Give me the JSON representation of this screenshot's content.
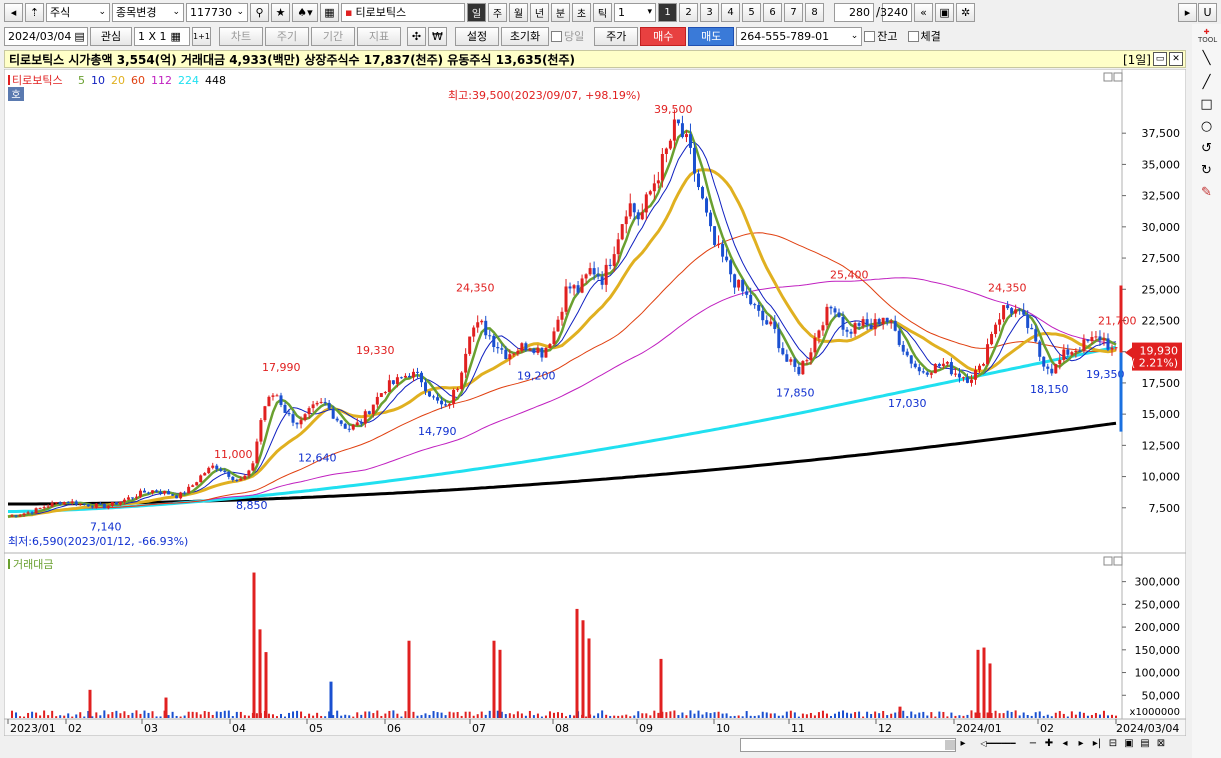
{
  "toolbar": {
    "market_label": "주식",
    "change_label": "종목변경",
    "code_value": "117730",
    "stock_name": "티로보틱스",
    "periods": [
      "일",
      "주",
      "월",
      "년",
      "분",
      "초",
      "틱"
    ],
    "period_count": "1",
    "page_buttons": [
      "1",
      "2",
      "3",
      "4",
      "5",
      "6",
      "7",
      "8"
    ],
    "count_value": "280",
    "total_value": "3240",
    "date_value": "2024/03/04",
    "watch_label": "관심",
    "ratio_label": "1 X 1",
    "plus_one_label": "1+1",
    "chart_label": "차트",
    "cycle_label": "주기",
    "range_label": "기간",
    "indicator_label": "지표",
    "won_label": "₩",
    "settings_label": "설정",
    "reset_label": "초기화",
    "same_day_label": "당일",
    "price_label": "주가",
    "buy_label": "매수",
    "sell_label": "매도",
    "account_value": "264-555-789-01",
    "balance_label": "잔고",
    "fill_label": "체결",
    "u_label": "U"
  },
  "right_tools": {
    "tool_label": "TOOL"
  },
  "info_bar": {
    "text": "티로보틱스  시가총액 3,554(억)  거래대금 4,933(백만)  상장주식수 17,837(천주)  유동주식 13,635(천주)",
    "period_tag": "[1일]"
  },
  "chart_data": [
    {
      "type": "candlestick",
      "name": "price",
      "legend": [
        "티로보틱스",
        "5",
        "10",
        "20",
        "60",
        "112",
        "224",
        "448"
      ],
      "legend_colors": [
        "#e02020",
        "#6aa030",
        "#1020c0",
        "#e0b020",
        "#e04010",
        "#c020c0",
        "#20e0f0",
        "#000000"
      ],
      "hoga_label": "호",
      "y_ticks": [
        7500,
        10000,
        12500,
        15000,
        17500,
        20000,
        22500,
        25000,
        27500,
        30000,
        32500,
        35000,
        37500
      ],
      "y_tick_labels": [
        "7,500",
        "10,000",
        "12,500",
        "15,000",
        "17,500",
        "20,000",
        "22,500",
        "25,000",
        "27,500",
        "30,000",
        "32,500",
        "35,000",
        "37,500"
      ],
      "ylim": [
        5000,
        42000
      ],
      "x_tick_labels": [
        "2023/01",
        "02",
        "03",
        "04",
        "05",
        "06",
        "07",
        "08",
        "09",
        "10",
        "11",
        "12",
        "2024/01",
        "02",
        "2024/03/04"
      ],
      "closes_weekly": [
        6800,
        7000,
        7200,
        7600,
        7900,
        8000,
        7800,
        7700,
        7600,
        7900,
        8300,
        8700,
        8900,
        8700,
        8400,
        9100,
        10200,
        10900,
        10300,
        9600,
        10400,
        15500,
        16800,
        14900,
        14200,
        15400,
        15900,
        14700,
        13800,
        14300,
        15800,
        17100,
        17600,
        18300,
        17800,
        16200,
        15400,
        17300,
        21800,
        22100,
        20800,
        19800,
        20300,
        20600,
        19900,
        21800,
        25200,
        24900,
        26700,
        25800,
        28800,
        32000,
        30600,
        33200,
        35500,
        38300,
        36200,
        32500,
        28700,
        27100,
        25300,
        24100,
        22600,
        21800,
        19300,
        18400,
        20100,
        22600,
        23800,
        21400,
        22300,
        21900,
        22900,
        21600,
        19700,
        18400,
        18700,
        19000,
        18300,
        17900,
        18600,
        21900,
        23600,
        23200,
        21900,
        19400,
        18500,
        19900,
        20300,
        20800,
        21200,
        19900
      ],
      "ma_labels": [
        {
          "text": "최고:39,500(2023/09/07, +98.19%)",
          "color": "#e02020"
        },
        {
          "text": "39,500",
          "color": "#e02020"
        },
        {
          "text": "최저:6,590(2023/01/12, -66.93%)",
          "color": "#1030d0"
        }
      ],
      "peak_labels": [
        {
          "text": "11,000",
          "value": 11000,
          "color": "#e02020"
        },
        {
          "text": "17,990",
          "value": 17990,
          "color": "#e02020"
        },
        {
          "text": "19,330",
          "value": 19330,
          "color": "#e02020"
        },
        {
          "text": "24,350",
          "value": 24350,
          "color": "#e02020"
        },
        {
          "text": "25,400",
          "value": 25400,
          "color": "#e02020"
        },
        {
          "text": "24,350",
          "value": 24350,
          "color": "#e02020"
        },
        {
          "text": "21,700",
          "value": 21700,
          "color": "#e02020"
        },
        {
          "text": "7,140",
          "value": 7140,
          "color": "#1030d0"
        },
        {
          "text": "8,850",
          "value": 8850,
          "color": "#1030d0"
        },
        {
          "text": "12,640",
          "value": 12640,
          "color": "#1030d0"
        },
        {
          "text": "14,790",
          "value": 14790,
          "color": "#1030d0"
        },
        {
          "text": "19,200",
          "value": 19200,
          "color": "#1030d0"
        },
        {
          "text": "17,850",
          "value": 17850,
          "color": "#1030d0"
        },
        {
          "text": "17,030",
          "value": 17030,
          "color": "#1030d0"
        },
        {
          "text": "18,150",
          "value": 18150,
          "color": "#1030d0"
        },
        {
          "text": "19,350",
          "value": 19350,
          "color": "#1030d0"
        }
      ],
      "current_price": {
        "value": 19930,
        "label": "19,930",
        "change": "( 2.21%)",
        "color": "#e02020"
      }
    },
    {
      "type": "bar",
      "name": "거래대금",
      "legend": [
        "거래대금"
      ],
      "y_ticks": [
        50000,
        100000,
        150000,
        200000,
        250000,
        300000
      ],
      "y_tick_labels": [
        "50,000",
        "100,000",
        "150,000",
        "200,000",
        "250,000",
        "300,000"
      ],
      "unit_label": "x1000000",
      "ylim": [
        0,
        330000
      ],
      "spikes": [
        {
          "month": "02",
          "value": 62000,
          "color": "#e02020"
        },
        {
          "month": "03",
          "value": 45000,
          "color": "#e02020"
        },
        {
          "month": "04",
          "value": 320000,
          "color": "#e02020"
        },
        {
          "month": "04",
          "value": 195000,
          "color": "#e02020"
        },
        {
          "month": "04",
          "value": 145000,
          "color": "#e02020"
        },
        {
          "month": "05",
          "value": 80000,
          "color": "#1a50d0"
        },
        {
          "month": "06",
          "value": 170000,
          "color": "#e02020"
        },
        {
          "month": "07",
          "value": 170000,
          "color": "#e02020"
        },
        {
          "month": "07",
          "value": 150000,
          "color": "#e02020"
        },
        {
          "month": "08",
          "value": 240000,
          "color": "#e02020"
        },
        {
          "month": "08",
          "value": 215000,
          "color": "#e02020"
        },
        {
          "month": "08",
          "value": 175000,
          "color": "#e02020"
        },
        {
          "month": "09",
          "value": 130000,
          "color": "#e02020"
        },
        {
          "month": "12",
          "value": 25000,
          "color": "#e02020"
        },
        {
          "month": "2024/01",
          "value": 150000,
          "color": "#e02020"
        },
        {
          "month": "2024/01",
          "value": 155000,
          "color": "#e02020"
        },
        {
          "month": "2024/01",
          "value": 120000,
          "color": "#e02020"
        }
      ]
    }
  ]
}
